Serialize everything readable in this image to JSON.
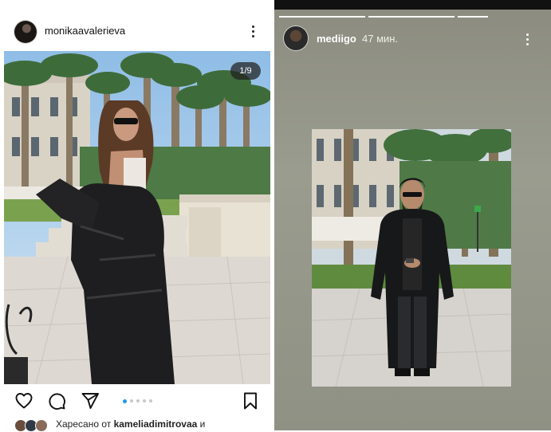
{
  "post": {
    "username": "monikaavalerieva",
    "counter": "1/9",
    "liked_by_prefix": "Харесано от ",
    "liked_by_user": "kameliadimitrovaa",
    "liked_by_suffix": " и",
    "carousel": {
      "total_dots": 5,
      "active_index": 0
    },
    "icons": [
      "heart-icon",
      "comment-icon",
      "share-icon",
      "bookmark-icon",
      "more-vertical-icon"
    ]
  },
  "story": {
    "username": "mediigo",
    "time": "47 мин.",
    "segments": {
      "total": 3,
      "completed": 3
    },
    "icons": [
      "more-vertical-icon"
    ]
  },
  "colors": {
    "accent_dot": "#1d9bf0",
    "story_bg": "#9a9c8f"
  }
}
